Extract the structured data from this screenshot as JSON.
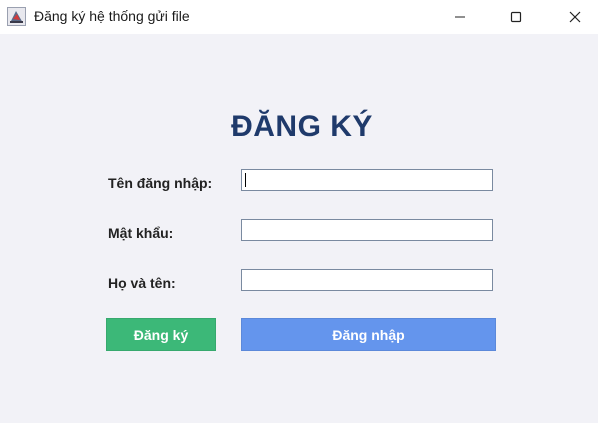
{
  "window": {
    "title": "Đăng ký hệ thống gửi file",
    "icon": "java-app-icon"
  },
  "form": {
    "heading": "ĐĂNG KÝ",
    "username_label": "Tên đăng nhập:",
    "username_value": "",
    "password_label": "Mật khẩu:",
    "password_value": "",
    "fullname_label": "Họ và tên:",
    "fullname_value": "",
    "register_button": "Đăng ký",
    "login_button": "Đăng nhập"
  },
  "colors": {
    "heading": "#1f3a6b",
    "register_button": "#3cb878",
    "login_button": "#6495ed",
    "background": "#f2f2f7"
  }
}
